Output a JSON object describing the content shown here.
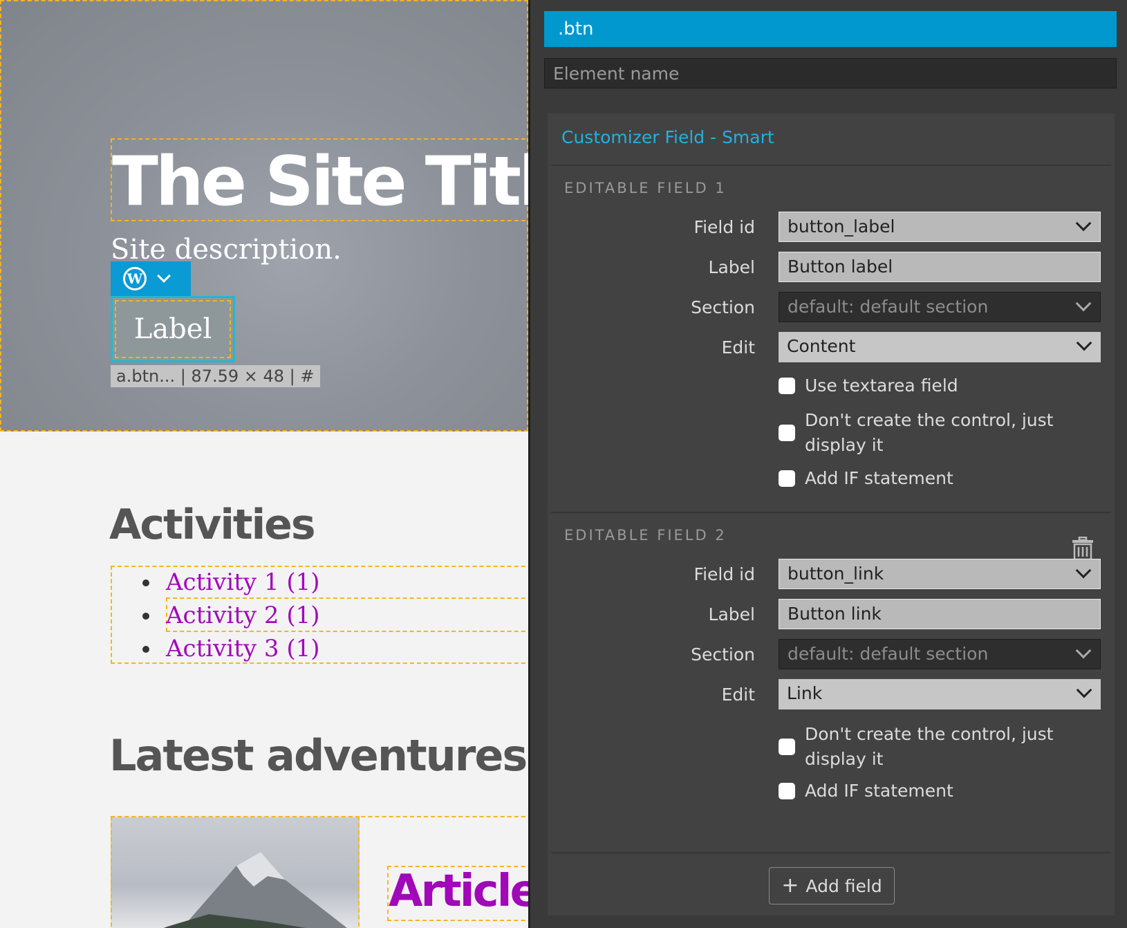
{
  "preview": {
    "site_title": "The Site Title",
    "site_description": "Site description.",
    "wp_logo_glyph": "W",
    "button_label": "Label",
    "element_info": "a.btn... | 87.59 × 48 | #",
    "activities_heading": "Activities",
    "activities": [
      "Activity 1 (1)",
      "Activity 2 (1)",
      "Activity 3 (1)"
    ],
    "latest_heading": "Latest adventures",
    "article_title": "Article",
    "link_color": "#a008b8",
    "outline_color": "#f5b51c"
  },
  "panel": {
    "selector": ".btn",
    "element_name_placeholder": "Element name",
    "card_title": "Customizer Field - Smart",
    "accent_color": "#0098cf",
    "field1": {
      "heading": "EDITABLE FIELD 1",
      "field_id_label": "Field id",
      "field_id_value": "button_label",
      "label_label": "Label",
      "label_value": "Button label",
      "section_label": "Section",
      "section_value": "default: default section",
      "edit_label": "Edit",
      "edit_value": "Content",
      "opt_textarea": "Use textarea field",
      "opt_display_line1": "Don't create the control, just",
      "opt_display_line2": "display it",
      "opt_if": "Add IF statement"
    },
    "field2": {
      "heading": "EDITABLE FIELD 2",
      "delete_icon": "trash-icon",
      "field_id_label": "Field id",
      "field_id_value": "button_link",
      "label_label": "Label",
      "label_value": "Button link",
      "section_label": "Section",
      "section_value": "default: default section",
      "edit_label": "Edit",
      "edit_value": "Link",
      "opt_display_line1": "Don't create the control, just",
      "opt_display_line2": "display it",
      "opt_if": "Add IF statement"
    },
    "add_field_label": "Add field",
    "add_field_icon": "+"
  }
}
